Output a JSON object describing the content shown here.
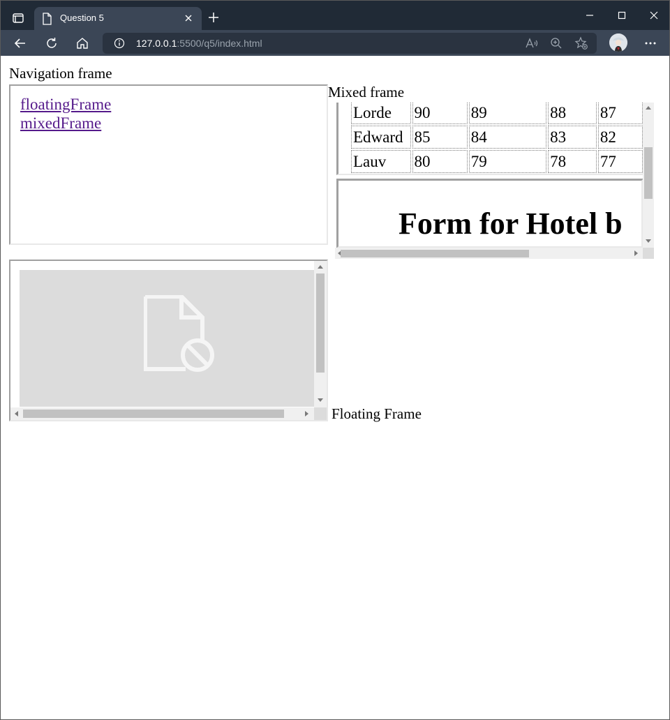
{
  "browser": {
    "tab_title": "Question 5",
    "url_host": "127.0.0.1",
    "url_rest": ":5500/q5/index.html"
  },
  "page": {
    "navigation_caption": "Navigation frame",
    "links": [
      "floatingFrame",
      "mixedFrame"
    ],
    "mixed_caption": "Mixed frame",
    "table_rows": [
      [
        "Lorde",
        "90",
        "89",
        "88",
        "87"
      ],
      [
        "Edward",
        "85",
        "84",
        "83",
        "82"
      ],
      [
        "Lauv",
        "80",
        "79",
        "78",
        "77"
      ]
    ],
    "form_heading": "Form for Hotel b",
    "floating_caption": "Floating Frame"
  },
  "colors": {
    "titlebar": "#202a36",
    "toolbar": "#3b4656",
    "link_visited": "#551a8b"
  }
}
